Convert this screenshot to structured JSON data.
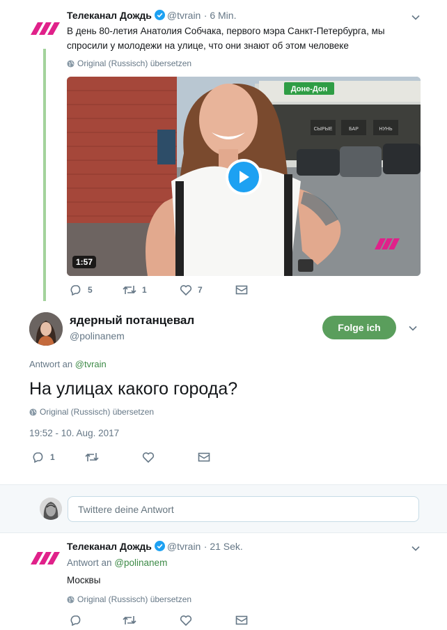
{
  "tweet1": {
    "name": "Телеканал Дождь",
    "handle": "@tvrain",
    "time": "· 6 Min.",
    "text_line1": "В день 80-летия Анатолия Собчака, первого мэра Санкт-Петербурга, мы",
    "text_line2": "спросили у молодежи на улице, что они знают об этом человеке",
    "translate": "Original (Russisch) übersetzen",
    "video": {
      "duration": "1:57",
      "sign_text": "Доне-Дон",
      "shop_signs": [
        "СЫРЫЕ",
        "БАР",
        "НУНЬ"
      ]
    },
    "replies": "5",
    "retweets": "1",
    "likes": "7"
  },
  "main_tweet": {
    "name": "ядерный потанцевал",
    "handle": "@polinanem",
    "follow_label": "Folge ich",
    "reply_to_label": "Antwort an",
    "reply_to_handle": "@tvrain",
    "text": "На улицах какого города?",
    "translate": "Original (Russisch) übersetzen",
    "timestamp": "19:52 - 10. Aug. 2017",
    "replies": "1"
  },
  "reply_box": {
    "placeholder": "Twittere deine Antwort"
  },
  "tweet3": {
    "name": "Телеканал Дождь",
    "handle": "@tvrain",
    "time": "· 21 Sek.",
    "reply_to_label": "Antwort an",
    "reply_to_handle": "@polinanem",
    "text": "Москвы",
    "translate": "Original (Russisch) übersetzen"
  },
  "colors": {
    "thread_line": "#a3d39c",
    "brand": "#e0218a",
    "follow_button": "#5a9e5c",
    "verified": "#1da1f2",
    "link_green": "#3c8a46"
  }
}
